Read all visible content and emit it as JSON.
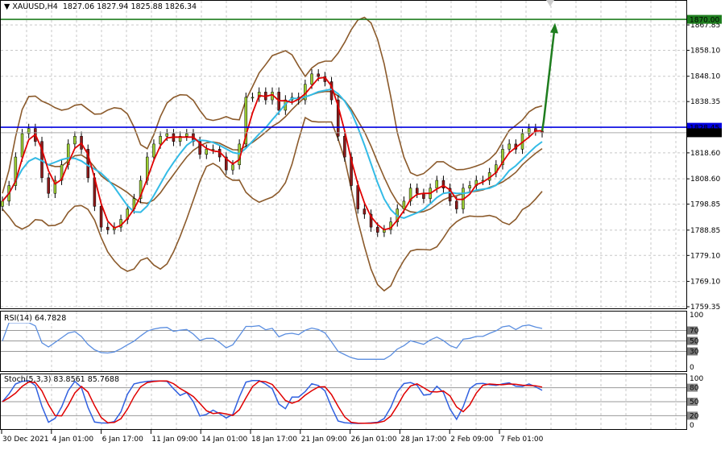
{
  "header": {
    "symbol": "XAUUSD,H4",
    "ohlc": "1827.06 1827.94 1825.88 1826.34",
    "menu_icon": "triangle-down-icon"
  },
  "rsi": {
    "label": "RSI(14) 64.7828",
    "levels": [
      "100",
      "70",
      "50",
      "30",
      "0"
    ]
  },
  "stoch": {
    "label": "Stoch(5,3,3) 83.8561 85.7688",
    "levels": [
      "100",
      "80",
      "50",
      "20",
      "0"
    ]
  },
  "colors": {
    "bull": "#9acd32",
    "bear": "#8b1a1a",
    "ma_fast": "#e00000",
    "ma_slow": "#33bbe6",
    "bollinger": "#8b5a2b",
    "resistance": "#0000e0",
    "target": "#1e7d1e",
    "rsi": "#5b8ee0",
    "stoch_main": "#3060e0",
    "stoch_signal": "#e00000"
  },
  "chart_data": {
    "type": "candlestick",
    "title": "XAUUSD,H4",
    "y_ticks": [
      "1867.85",
      "1858.10",
      "1848.10",
      "1838.35",
      "1818.60",
      "1808.60",
      "1798.85",
      "1788.85",
      "1779.10",
      "1769.10",
      "1759.35"
    ],
    "ylim": [
      1759.35,
      1870.5
    ],
    "x_ticks": [
      "30 Dec 2021",
      "4 Jan 01:00",
      "6 Jan 17:00",
      "11 Jan 09:00",
      "14 Jan 01:00",
      "18 Jan 17:00",
      "21 Jan 09:00",
      "26 Jan 01:00",
      "28 Jan 17:00",
      "2 Feb 09:00",
      "7 Feb 01:00"
    ],
    "closes": [
      1800,
      1806,
      1817,
      1826,
      1828,
      1823,
      1809,
      1803,
      1808,
      1814,
      1822,
      1825,
      1820,
      1809,
      1798,
      1790,
      1789,
      1790,
      1793,
      1797,
      1801,
      1808,
      1817,
      1822,
      1825,
      1826,
      1823,
      1825,
      1826,
      1823,
      1818,
      1820,
      1820,
      1817,
      1812,
      1814,
      1822,
      1840,
      1840,
      1842,
      1839,
      1842,
      1835,
      1839,
      1840,
      1839,
      1845,
      1849,
      1848,
      1846,
      1839,
      1825,
      1817,
      1806,
      1797,
      1795,
      1790,
      1788,
      1789,
      1792,
      1797,
      1800,
      1805,
      1803,
      1801,
      1805,
      1808,
      1805,
      1800,
      1797,
      1805,
      1806,
      1808,
      1808,
      1811,
      1814,
      1820,
      1822,
      1820,
      1826,
      1828,
      1827,
      1826.34
    ],
    "horizontal_lines": [
      {
        "price": 1870.0,
        "label": "1870.00",
        "color": "#1e7d1e"
      },
      {
        "price": 1828.45,
        "label": "1828.45",
        "color": "#0000e0"
      },
      {
        "price": 1826.34,
        "label": "1826.34",
        "color": "#000000"
      }
    ],
    "target_arrow": {
      "from_price": 1831,
      "to_price": 1868,
      "direction": "up"
    },
    "grid": true
  }
}
